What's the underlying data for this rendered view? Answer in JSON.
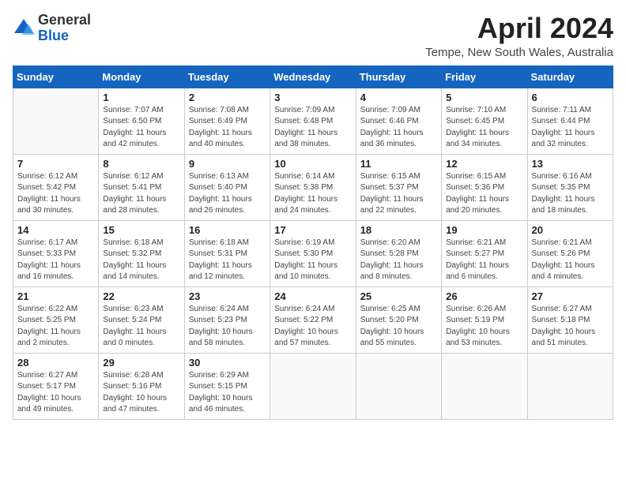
{
  "logo": {
    "general": "General",
    "blue": "Blue"
  },
  "title": "April 2024",
  "location": "Tempe, New South Wales, Australia",
  "days_of_week": [
    "Sunday",
    "Monday",
    "Tuesday",
    "Wednesday",
    "Thursday",
    "Friday",
    "Saturday"
  ],
  "weeks": [
    [
      {
        "day": "",
        "info": ""
      },
      {
        "day": "1",
        "info": "Sunrise: 7:07 AM\nSunset: 6:50 PM\nDaylight: 11 hours\nand 42 minutes."
      },
      {
        "day": "2",
        "info": "Sunrise: 7:08 AM\nSunset: 6:49 PM\nDaylight: 11 hours\nand 40 minutes."
      },
      {
        "day": "3",
        "info": "Sunrise: 7:09 AM\nSunset: 6:48 PM\nDaylight: 11 hours\nand 38 minutes."
      },
      {
        "day": "4",
        "info": "Sunrise: 7:09 AM\nSunset: 6:46 PM\nDaylight: 11 hours\nand 36 minutes."
      },
      {
        "day": "5",
        "info": "Sunrise: 7:10 AM\nSunset: 6:45 PM\nDaylight: 11 hours\nand 34 minutes."
      },
      {
        "day": "6",
        "info": "Sunrise: 7:11 AM\nSunset: 6:44 PM\nDaylight: 11 hours\nand 32 minutes."
      }
    ],
    [
      {
        "day": "7",
        "info": "Sunrise: 6:12 AM\nSunset: 5:42 PM\nDaylight: 11 hours\nand 30 minutes."
      },
      {
        "day": "8",
        "info": "Sunrise: 6:12 AM\nSunset: 5:41 PM\nDaylight: 11 hours\nand 28 minutes."
      },
      {
        "day": "9",
        "info": "Sunrise: 6:13 AM\nSunset: 5:40 PM\nDaylight: 11 hours\nand 26 minutes."
      },
      {
        "day": "10",
        "info": "Sunrise: 6:14 AM\nSunset: 5:38 PM\nDaylight: 11 hours\nand 24 minutes."
      },
      {
        "day": "11",
        "info": "Sunrise: 6:15 AM\nSunset: 5:37 PM\nDaylight: 11 hours\nand 22 minutes."
      },
      {
        "day": "12",
        "info": "Sunrise: 6:15 AM\nSunset: 5:36 PM\nDaylight: 11 hours\nand 20 minutes."
      },
      {
        "day": "13",
        "info": "Sunrise: 6:16 AM\nSunset: 5:35 PM\nDaylight: 11 hours\nand 18 minutes."
      }
    ],
    [
      {
        "day": "14",
        "info": "Sunrise: 6:17 AM\nSunset: 5:33 PM\nDaylight: 11 hours\nand 16 minutes."
      },
      {
        "day": "15",
        "info": "Sunrise: 6:18 AM\nSunset: 5:32 PM\nDaylight: 11 hours\nand 14 minutes."
      },
      {
        "day": "16",
        "info": "Sunrise: 6:18 AM\nSunset: 5:31 PM\nDaylight: 11 hours\nand 12 minutes."
      },
      {
        "day": "17",
        "info": "Sunrise: 6:19 AM\nSunset: 5:30 PM\nDaylight: 11 hours\nand 10 minutes."
      },
      {
        "day": "18",
        "info": "Sunrise: 6:20 AM\nSunset: 5:28 PM\nDaylight: 11 hours\nand 8 minutes."
      },
      {
        "day": "19",
        "info": "Sunrise: 6:21 AM\nSunset: 5:27 PM\nDaylight: 11 hours\nand 6 minutes."
      },
      {
        "day": "20",
        "info": "Sunrise: 6:21 AM\nSunset: 5:26 PM\nDaylight: 11 hours\nand 4 minutes."
      }
    ],
    [
      {
        "day": "21",
        "info": "Sunrise: 6:22 AM\nSunset: 5:25 PM\nDaylight: 11 hours\nand 2 minutes."
      },
      {
        "day": "22",
        "info": "Sunrise: 6:23 AM\nSunset: 5:24 PM\nDaylight: 11 hours\nand 0 minutes."
      },
      {
        "day": "23",
        "info": "Sunrise: 6:24 AM\nSunset: 5:23 PM\nDaylight: 10 hours\nand 58 minutes."
      },
      {
        "day": "24",
        "info": "Sunrise: 6:24 AM\nSunset: 5:22 PM\nDaylight: 10 hours\nand 57 minutes."
      },
      {
        "day": "25",
        "info": "Sunrise: 6:25 AM\nSunset: 5:20 PM\nDaylight: 10 hours\nand 55 minutes."
      },
      {
        "day": "26",
        "info": "Sunrise: 6:26 AM\nSunset: 5:19 PM\nDaylight: 10 hours\nand 53 minutes."
      },
      {
        "day": "27",
        "info": "Sunrise: 6:27 AM\nSunset: 5:18 PM\nDaylight: 10 hours\nand 51 minutes."
      }
    ],
    [
      {
        "day": "28",
        "info": "Sunrise: 6:27 AM\nSunset: 5:17 PM\nDaylight: 10 hours\nand 49 minutes."
      },
      {
        "day": "29",
        "info": "Sunrise: 6:28 AM\nSunset: 5:16 PM\nDaylight: 10 hours\nand 47 minutes."
      },
      {
        "day": "30",
        "info": "Sunrise: 6:29 AM\nSunset: 5:15 PM\nDaylight: 10 hours\nand 46 minutes."
      },
      {
        "day": "",
        "info": ""
      },
      {
        "day": "",
        "info": ""
      },
      {
        "day": "",
        "info": ""
      },
      {
        "day": "",
        "info": ""
      }
    ]
  ]
}
